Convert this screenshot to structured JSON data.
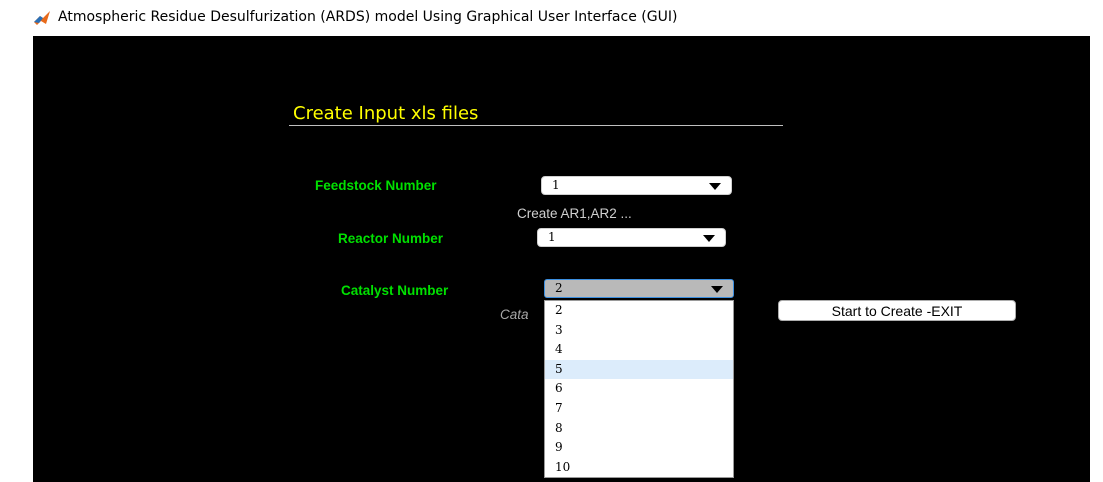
{
  "window": {
    "title": "Atmospheric Residue Desulfurization (ARDS) model  Using  Graphical  User Interface (GUI)",
    "icon": "matlab-icon"
  },
  "panel": {
    "title": "Create Input xls files"
  },
  "feedstock": {
    "label": "Feedstock Number",
    "value": "1",
    "hint": "Create AR1,AR2 ..."
  },
  "reactor": {
    "label": "Reactor Number",
    "value": "1"
  },
  "catalyst": {
    "label": "Catalyst  Number",
    "value": "2",
    "hint_partial": "Cata",
    "options": [
      "2",
      "3",
      "4",
      "5",
      "6",
      "7",
      "8",
      "9",
      "10"
    ],
    "hovered_option": "5"
  },
  "start_button": {
    "label": "Start to Create -EXIT"
  },
  "colors": {
    "background": "#000000",
    "label_green": "#00e000",
    "title_yellow": "#ffff00",
    "focus_blue": "#3c8fe0",
    "hover_blue": "#dcecfb"
  }
}
